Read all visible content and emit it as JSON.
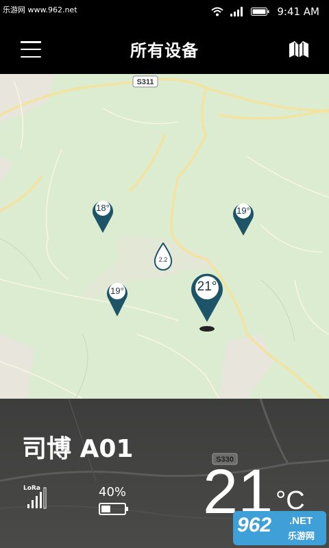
{
  "status_bar": {
    "watermark": "乐游网 www.962.net",
    "time": "9:41 AM"
  },
  "app_bar": {
    "title": "所有设备",
    "menu_icon": "hamburger-menu-icon",
    "map_icon": "map-icon"
  },
  "map": {
    "road_labels": [
      "S311"
    ],
    "markers": [
      {
        "label": "18°",
        "type": "temperature"
      },
      {
        "label": "19°",
        "type": "temperature"
      },
      {
        "label": "2.2",
        "type": "rain"
      },
      {
        "label": "19°",
        "type": "temperature"
      },
      {
        "label": "21°",
        "type": "temperature-selected"
      }
    ],
    "colors": {
      "land": "#dcecd0",
      "road": "#f6e7a6",
      "pin": "#1d5468"
    }
  },
  "device_panel": {
    "name": "司博 A01",
    "signal_label": "LoRa",
    "battery_percent": "40%",
    "battery_level": 0.4,
    "temperature_value": "21",
    "temperature_unit": "°C",
    "road_label": "S330"
  },
  "watermark_br": {
    "number": "962",
    "net": ".NET",
    "site": "乐游网"
  }
}
